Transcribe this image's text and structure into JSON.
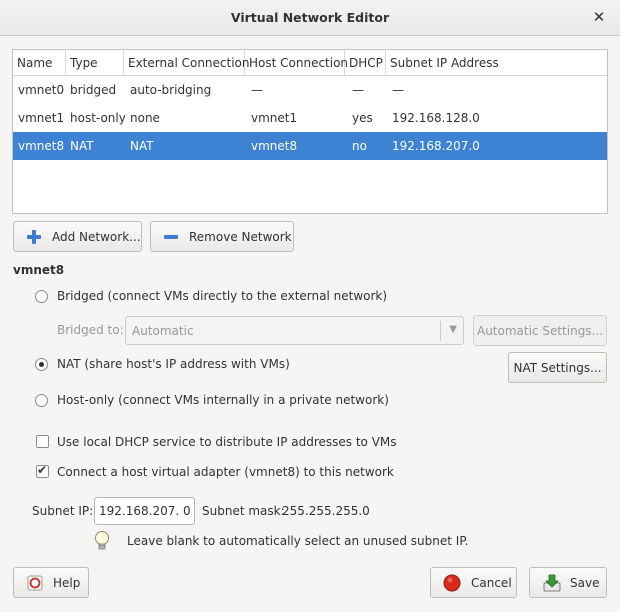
{
  "window": {
    "title": "Virtual Network Editor",
    "close_glyph": "✕"
  },
  "table": {
    "headers": [
      "Name",
      "Type",
      "External Connection",
      "Host Connection",
      "DHCP",
      "Subnet IP Address"
    ],
    "rows": [
      {
        "name": "vmnet0",
        "type": "bridged",
        "external": "auto-bridging",
        "host": "—",
        "dhcp": "—",
        "subnet": "—",
        "selected": false
      },
      {
        "name": "vmnet1",
        "type": "host-only",
        "external": "none",
        "host": "vmnet1",
        "dhcp": "yes",
        "subnet": "192.168.128.0",
        "selected": false
      },
      {
        "name": "vmnet8",
        "type": "NAT",
        "external": "NAT",
        "host": "vmnet8",
        "dhcp": "no",
        "subnet": "192.168.207.0",
        "selected": true
      }
    ]
  },
  "buttons": {
    "add_network": "Add Network...",
    "remove_network": "Remove Network",
    "automatic_settings": "Automatic Settings...",
    "nat_settings": "NAT Settings...",
    "help": "Help",
    "cancel": "Cancel",
    "save": "Save"
  },
  "selected_network": "vmnet8",
  "options": {
    "bridged": "Bridged (connect VMs directly to the external network)",
    "bridged_to_label": "Bridged to:",
    "bridged_to_value": "Automatic",
    "nat": "NAT (share host's IP address with VMs)",
    "host_only": "Host-only (connect VMs internally in a private network)",
    "connection_type": "nat",
    "use_dhcp": "Use local DHCP service to distribute IP addresses to VMs",
    "use_dhcp_checked": false,
    "connect_adapter": "Connect a host virtual adapter (vmnet8) to this network",
    "connect_adapter_checked": true
  },
  "subnet": {
    "ip_label": "Subnet IP:",
    "ip_value": "192.168.207. 0",
    "mask_label": "Subnet mask:",
    "mask_value": "255.255.255.0",
    "hint": "Leave blank to automatically select an unused subnet IP."
  },
  "colors": {
    "selection": "#3d82d3",
    "add_icon": "#3b7bd0",
    "cancel_icon": "#d9291c",
    "save_icon": "#3a9a3a"
  }
}
